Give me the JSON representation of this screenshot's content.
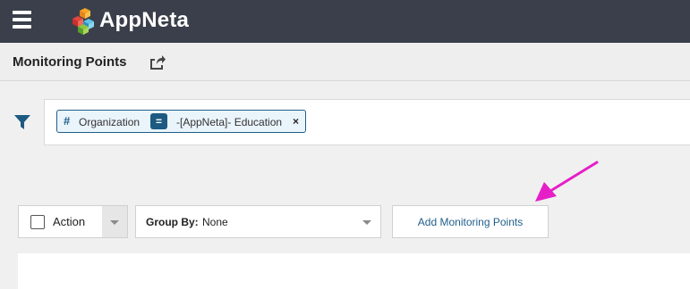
{
  "topbar": {
    "brand": "AppNeta"
  },
  "header": {
    "title": "Monitoring Points"
  },
  "filter": {
    "chip": {
      "field": "Organization",
      "operator": "=",
      "value": "-[AppNeta]- Education",
      "close": "×",
      "hash": "#"
    }
  },
  "toolbar": {
    "action_label": "Action",
    "group_by_label": "Group By:",
    "group_by_value": "None",
    "add_button": "Add Monitoring Points"
  },
  "colors": {
    "topbar": "#3a3f4b",
    "accent": "#1f5f8a",
    "annotation_arrow": "#e61ec8"
  },
  "icons": [
    "hamburger-icon",
    "appneta-logo",
    "share-icon",
    "filter-icon",
    "chevron-down-icon",
    "annotation-arrow"
  ]
}
